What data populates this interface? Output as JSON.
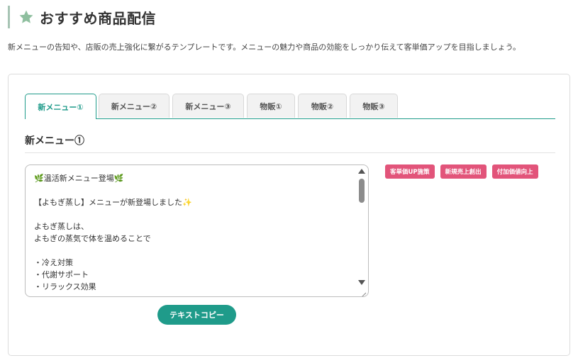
{
  "header": {
    "title": "おすすめ商品配信",
    "icon": "star-icon",
    "icon_color": "#8fbf9f",
    "accent_border_color": "#a7c4b4"
  },
  "description": "新メニューの告知や、店販の売上強化に繋がるテンプレートです。メニューの魅力や商品の効能をしっかり伝えて客単価アップを目指しましょう。",
  "tabs": [
    {
      "label": "新メニュー①",
      "active": true
    },
    {
      "label": "新メニュー②",
      "active": false
    },
    {
      "label": "新メニュー③",
      "active": false
    },
    {
      "label": "物販①",
      "active": false
    },
    {
      "label": "物販②",
      "active": false
    },
    {
      "label": "物販③",
      "active": false
    }
  ],
  "section": {
    "title": "新メニュー①"
  },
  "template_text": {
    "lines": [
      "🌿温活新メニュー登場🌿",
      "",
      "【よもぎ蒸し】メニューが新登場しました✨",
      "",
      "よもぎ蒸しは、",
      "よもぎの蒸気で体を温めることで",
      "",
      "・冷え対策",
      "・代謝サポート",
      "・リラックス効果"
    ],
    "scroll_position": 0.0
  },
  "badges": [
    {
      "label": "客単価UP施策"
    },
    {
      "label": "新規売上創出"
    },
    {
      "label": "付加価値向上"
    }
  ],
  "badge_color": "#e2547a",
  "copy_button": {
    "label": "テキストコピー"
  },
  "accent_color": "#1f9b8a"
}
